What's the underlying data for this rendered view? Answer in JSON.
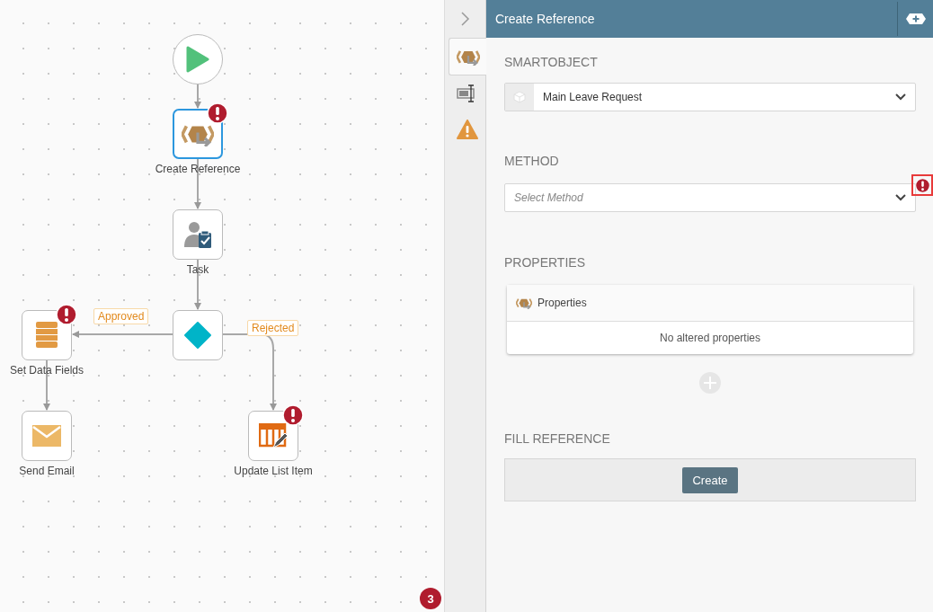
{
  "canvas": {
    "nodes": [
      {
        "kind": "start",
        "selected": false,
        "error": false
      },
      {
        "kind": "reference",
        "label": "Create Reference",
        "selected": true,
        "error": true
      },
      {
        "kind": "task",
        "label": "Task",
        "selected": false,
        "error": false
      },
      {
        "kind": "decision",
        "selected": false,
        "error": false
      },
      {
        "kind": "data",
        "label": "Set Data Fields",
        "selected": false,
        "error": true
      },
      {
        "kind": "email",
        "label": "Send Email",
        "selected": false,
        "error": false
      },
      {
        "kind": "list",
        "label": "Update List Item",
        "selected": false,
        "error": true
      }
    ],
    "edges": [
      {
        "label": "Approved"
      },
      {
        "label": "Rejected"
      }
    ],
    "error_count": "3"
  },
  "panel": {
    "title": "Create Reference",
    "tabs": [
      {
        "kind": "reference",
        "selected": true
      },
      {
        "kind": "form",
        "selected": false
      },
      {
        "kind": "warning",
        "selected": false
      }
    ],
    "smartobject": {
      "heading": "SMARTOBJECT",
      "value": "Main Leave Request"
    },
    "method": {
      "heading": "METHOD",
      "placeholder": "Select Method",
      "error": true
    },
    "properties": {
      "heading": "PROPERTIES",
      "card_title": "Properties",
      "empty_text": "No altered properties"
    },
    "fill_reference": {
      "heading": "FILL REFERENCE",
      "button": "Create"
    }
  }
}
